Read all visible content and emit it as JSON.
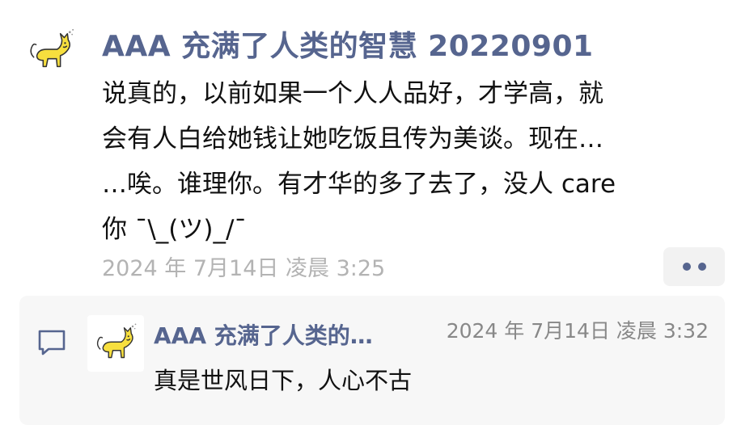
{
  "post": {
    "author": "AAA 充满了人类的智慧 20220901",
    "avatar_icon": "cat-icon",
    "content_lines": [
      "说真的，以前如果一个人人品好，才学高，就",
      "会有人白给她钱让她吃饭且传为美谈。现在…",
      "…唉。谁理你。有才华的多了去了，没人 care",
      "你 ¯\\_(ツ)_/¯"
    ],
    "timestamp": "2024 年 7月14日 凌晨 3:25",
    "more_icon": "more-dots-icon"
  },
  "comment": {
    "icon": "comment-icon",
    "author": "AAA 充满了人类的…",
    "timestamp": "2024 年 7月14日 凌晨 3:32",
    "text": "真是世风日下，人心不古"
  },
  "colors": {
    "author": "#56658f",
    "timestamp": "#b3b3b3",
    "comment_bg": "#f7f7f7",
    "cat_yellow": "#f7df3e"
  }
}
